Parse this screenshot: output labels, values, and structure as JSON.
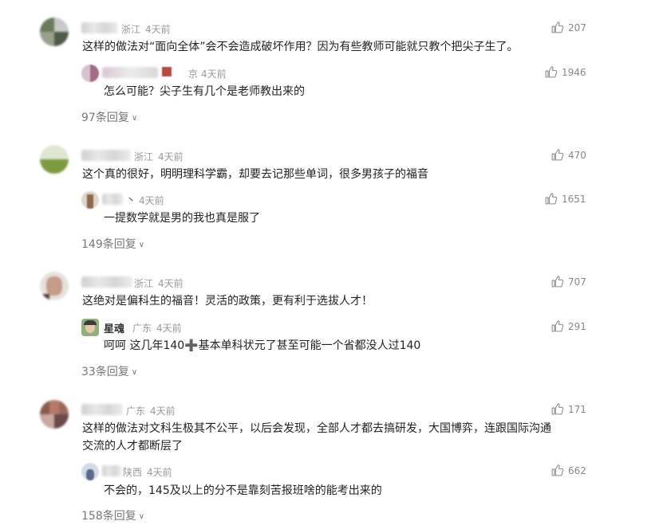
{
  "comments": [
    {
      "location": "浙江",
      "time": "4天前",
      "likes": "207",
      "text": "这样的做法对“面向全体”会不会造成破坏作用？因为有些教师可能就只教个把尖子生了。",
      "reply": {
        "name": "",
        "location": "京",
        "time": "4天前",
        "likes": "1946",
        "text": "怎么可能？尖子生有几个是老师教出来的"
      },
      "replies_link": "97条回复"
    },
    {
      "location": "浙江",
      "time": "4天前",
      "likes": "470",
      "text": "这个真的很好，明明理科学霸，却要去记那些单词，很多男孩子的福音",
      "reply": {
        "name": "丶",
        "location": "",
        "time": "4天前",
        "likes": "1651",
        "text": "一提数学就是男的我也真是服了"
      },
      "replies_link": "149条回复"
    },
    {
      "location": "浙江",
      "time": "4天前",
      "likes": "707",
      "text": "这绝对是偏科生的福音！灵活的政策，更有利于选拔人才！",
      "reply": {
        "name": "星魂",
        "location": "广东",
        "time": "4天前",
        "likes": "291",
        "text": "呵呵 这几年140➕基本单科状元了甚至可能一个省都没人过140"
      },
      "replies_link": "33条回复"
    },
    {
      "location": "广东",
      "time": "4天前",
      "likes": "171",
      "text_line1": "这样的做法对文科生极其不公平，以后会发现，全部人才都去搞研发，大国博弈，连跟国际沟通",
      "text_line2": "交流的人才都断层了",
      "reply": {
        "name": "",
        "location": "陕西",
        "time": "4天前",
        "likes": "662",
        "text": "不会的，145及以上的分不是靠刻苦报班啥的能考出来的"
      },
      "replies_link": "158条回复"
    }
  ],
  "icons": {
    "like": "thumbs-up-icon",
    "expand": "chevron-down-icon"
  }
}
